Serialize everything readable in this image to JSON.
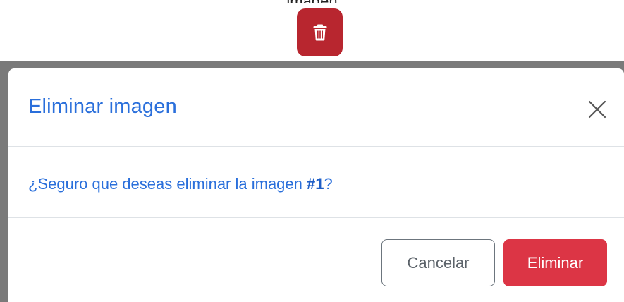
{
  "page": {
    "top_caption": "imagen"
  },
  "trash_button": {
    "icon": "trash-icon",
    "color": "#b8262f"
  },
  "modal": {
    "title": "Eliminar imagen",
    "close_icon": "close-icon",
    "message_prefix": "¿Seguro que deseas eliminar la imagen ",
    "message_highlight": "#1",
    "message_suffix": "?",
    "cancel_label": "Cancelar",
    "delete_label": "Eliminar",
    "colors": {
      "title": "#2a6fdb",
      "delete_button": "#dc3545",
      "backdrop": "#7a7a7a"
    }
  }
}
